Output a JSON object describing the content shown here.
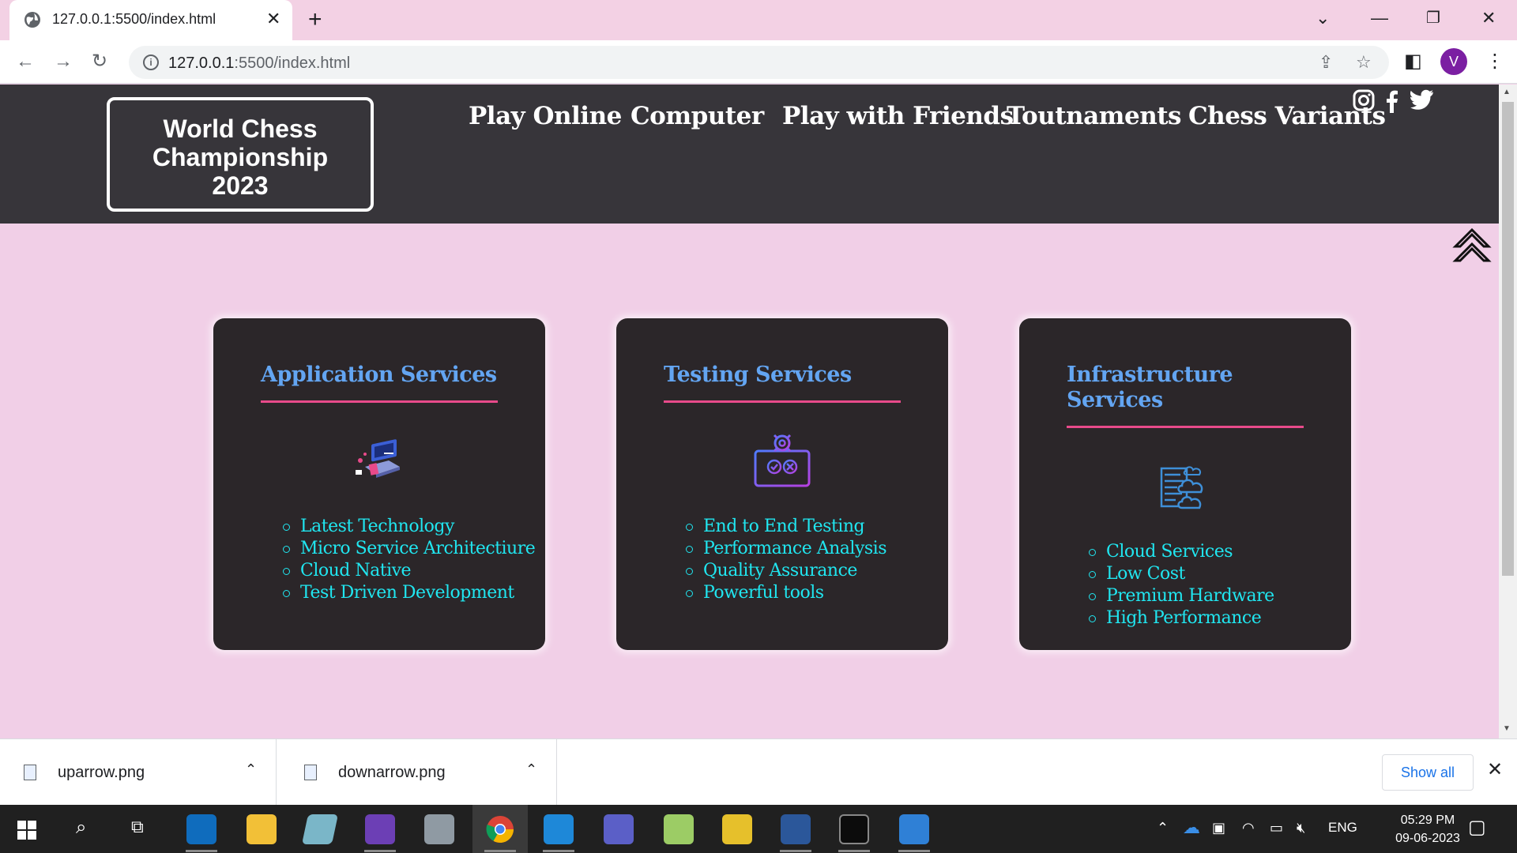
{
  "browser": {
    "tab_title": "127.0.0.1:5500/index.html",
    "url_host": "127.0.0.1",
    "url_rest": ":5500/index.html",
    "profile_initial": "V"
  },
  "header": {
    "logo_lines": [
      "World Chess",
      "Championship",
      "2023"
    ],
    "nav": [
      "Play Online",
      "Computer",
      "Play with Friends",
      "Toutnaments",
      "Chess Variants"
    ]
  },
  "cards": [
    {
      "title": "Application Services",
      "items": [
        "Latest Technology",
        "Micro Service Architectiure",
        "Cloud Native",
        "Test Driven Development"
      ]
    },
    {
      "title": "Testing Services",
      "items": [
        "End to End Testing",
        "Performance Analysis",
        "Quality Assurance",
        "Powerful tools"
      ]
    },
    {
      "title": "Infrastructure Services",
      "items": [
        "Cloud Services",
        "Low Cost",
        "Premium Hardware",
        "High Performance"
      ]
    }
  ],
  "downloads": {
    "files": [
      "uparrow.png",
      "downarrow.png"
    ],
    "show_all": "Show all"
  },
  "taskbar": {
    "language": "ENG",
    "time": "05:29 PM",
    "date": "09-06-2023"
  },
  "colors": {
    "page_bg": "#f1cfe7",
    "header_bg": "#37353a",
    "card_bg": "#2b2629",
    "card_title": "#63a5f2",
    "card_rule": "#e84a8a",
    "card_list": "#20e6f0"
  }
}
